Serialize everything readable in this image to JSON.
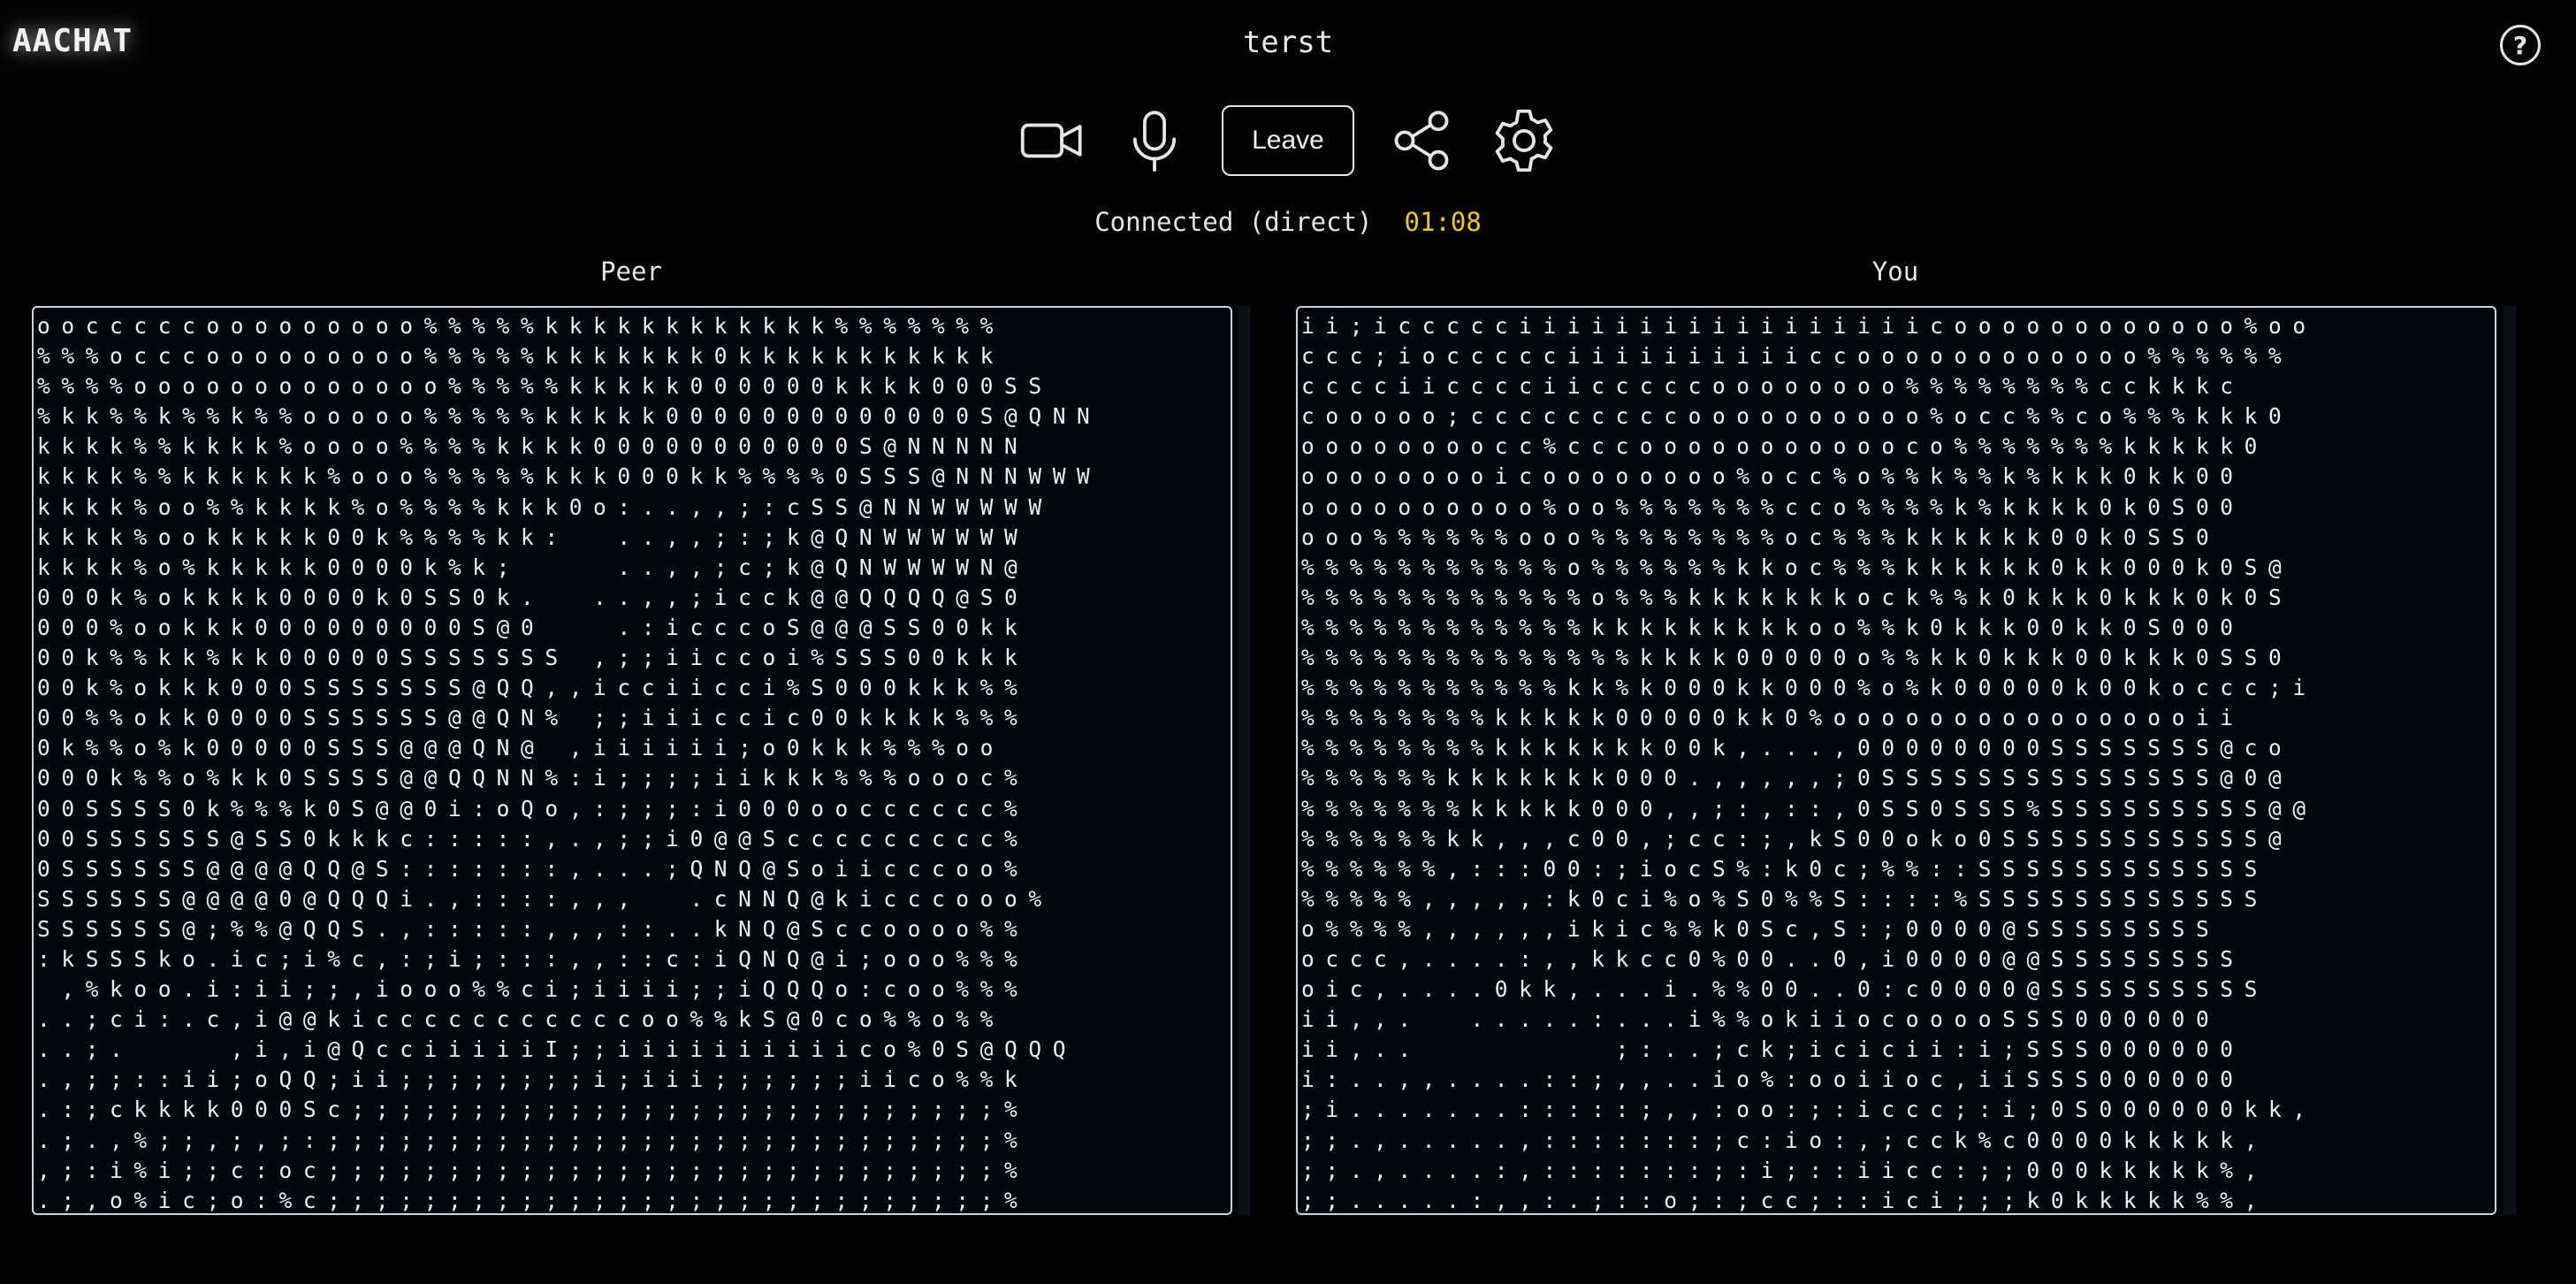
{
  "header": {
    "logo": "AACHAT",
    "room_title": "terst",
    "help_label": "?"
  },
  "toolbar": {
    "camera_icon": "video-camera-icon",
    "mic_icon": "microphone-icon",
    "leave_label": "Leave",
    "share_icon": "share-icon",
    "settings_icon": "gear-icon"
  },
  "status": {
    "connection": "Connected (direct)",
    "timer": "01:08",
    "timer_color": "#f5c518"
  },
  "peer": {
    "label": "Peer",
    "ascii": "oocccccooooooooo%%%%%kkkkkkkkkkkk%%%%%%%\n%%%occcooooooooo%%%%%kkkkkkk0kkkkkkkkkkk\n%%%%ooooooooooooo%%%%%kkkkk000000kkkk000SS\n%kk%%k%%k%%ooooo%%%%%kkkkk0000000000000S@QNN\nkkkk%%kkkk%oooo%%%%kkkk00000000000S@NNNNN\nkkkk%%kkkkkk%ooo%%%%%kkk000kk%%%%0SSS@NNNWWW\nkkkk%oo%%kkkk%o%%%%kkk0o:..,,;:cSS@NNWWWWW\nkkkk%ookkkkk00k%%%%kk:  ..,,;:;k@QNWWWWWW\nkkkk%o%kkkkk0000k%k;    ..,,;c;k@QNWWWWN@\n000k%okkkk0000k0SS0k.  ..,,;icck@@QQQQ@S0\n000%ookkk000000000S@0   .:icccoS@@@SS00kk\n00k%%kk%kk00000SSSSSSS ,;;iiccoi%SSS00kkk\n00k%okkk000SSSSSSS@QQ,,icciicci%S000kkk%%\n00%%okk0000SSSSSS@@QN% ;;iiiccic00kkkk%%%\n0k%%o%k00000SSS@@@QN@ ,iiiiii;o0kkk%%%oo\n000k%%o%kk0SSSS@@QQNN%:i;;;;iikkk%%%oooc%\n00SSSS0k%%%k0S@@0i:oQo,:;;;:i000oocccccc%\n00SSSSSS@SS0kkkc:::::,.,;;i0@@Sccccccccc%\n0SSSSSS@@@@QQ@S:::::::,...;QNQ@Soiicccoo%\nSSSSSS@@@@0@QQQi.,::::,,,  .cNNQ@kicccooo%\nSSSSSS@;%%@QQS.,:::::,,,::..kNQ@Sccoooo%%\n:kSSSko.ic;i%c,:;i;:::,,::c:iQNQ@i;ooo%%%\n ,%koo.i:ii;;,iooo%%ci;iiii;;iQQQo:coo%%%\n..;ci:.c,i@@kicccccccccccoo%%kS@0co%%o%%\n..;.    ,i,i@QcciiiiiI;;iiiiiiiiiico%0S@QQQ\n.,;;::ii;oQQ;ii;;;;;;;;i;iii;;;;;;iico%%k\n.:;ckkkk000Sc;;;;;;;;;;;;;;;;;;;;;;;;;;;%\n.;.,%;;,;,;:;;;;;;;;;;;;;;;;;;;;;;;;;;;;%\n,;:i%i;;c:oc;;;;;;;;;;;;;;;;;;;;;;;;;;;;%\n.;,o%ic;o:%c;;;;;;;;;;;;;;;;;;;;;;;;;;;;%"
  },
  "you": {
    "label": "You",
    "ascii": "ii;iccccciiiiiiiiiiiiiiiiicoooooooooooo%oo\nccc;ioccccciiiiiiiiiiccoooooooooooo%%%%%%\ncccciicccciicccccoooooooo%%%%%%%%cckkkc\ncooooo;cccccccccoooooooooo%occ%%co%%%kkk0\noooooooocc%cccoooooooooooco%%%%%%%kkkkk0\nooooooooicoooooooo%occ%o%%k%%k%kkk0kk00\noooooooooo%oo%%%%%%%cco%%%%k%kkkk0k0S00\nooo%%%%%%ooo%%%%%%%%oc%%%kkkkkk00k0SS0\n%%%%%%%%%%%o%%%%%%kkoc%%%kkkkkk0kk000k0S@\n%%%%%%%%%%%%o%%%kkkkkkkock%%k0kkk0kkk0k0S\n%%%%%%%%%%%%kkkkkkkkkoo%%k0kkk00kk0S000\n%%%%%%%%%%%%%%kkkk00000o%%kk0kkk00kkk0SS0\n%%%%%%%%%%%kk%k000kk000%o%k00000k00koccc;i\n%%%%%%%%kkkkk00000kk0%oooooooooooooooii\n%%%%%%%%kkkkkkk00k,...,00000000SSSSSSS@co\n%%%%%%kkkkkkk000.,,,,,;0SSSSSSSSSSSSSS@0@\n%%%%%%%kkkkk000,,;:,::,0SS0SSS%SSSSSSSSS@@\n%%%%%%kk,,,c00,;cc:;,kS00oko0SSSSSSSSSSS@\n%%%%%%,:::00:;iocS%:k0c;%%::SSSSSSSSSSSS\n%%%%%,,,,,:k0ci%o%S0%%S::::%SSSSSSSSSSSS\no%%%%,,,,,,ikic%%k0Sc,S:;0000@SSSSSSSS\noccc,....:,,kkcc0%00..0,i0000@@SSSSSSSS\noic,....0kk,...i.%%00..0:c0000@SSSSSSSSS\nii,,.  .....:...i%%okiiocooooSSS000000\nii,..        ;:..;ck;icicii:i;SSS000000\ni:..,,....::;,,..io%:ooiioc,iiSSS000000\n;i.......:::::;,,:oo:;:iccc;:i;0S000000kk,\n;;.,.....,:::::::;c:io:,;cck%c0000kkkkk,\n;;.,....:,:::::::;:i;::iicc:;;000kkkkk%,\n;;.....:,,:.;::o;:;cc;::ici;;;k0kkkkk%%,"
  }
}
